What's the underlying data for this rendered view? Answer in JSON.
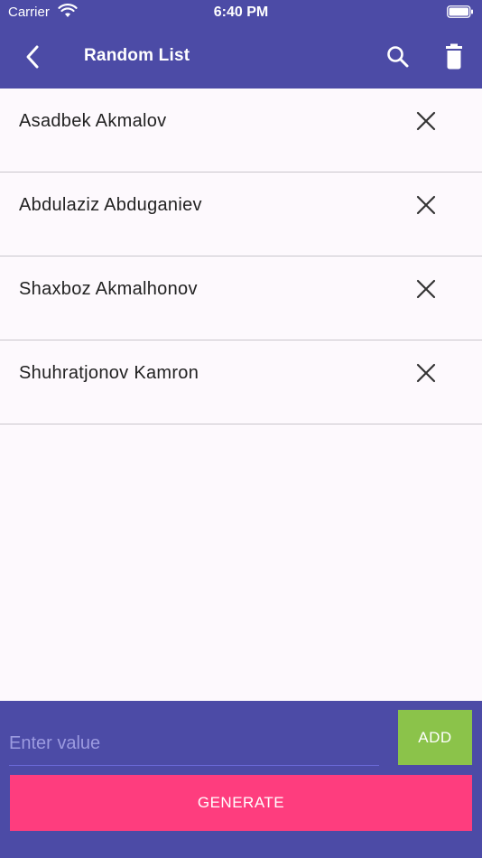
{
  "status": {
    "carrier": "Carrier",
    "time": "6:40 PM"
  },
  "appbar": {
    "title": "Random List"
  },
  "items": [
    {
      "name": "Asadbek  Akmalov"
    },
    {
      "name": "Abdulaziz Abduganiev"
    },
    {
      "name": "Shaxboz Akmalhonov"
    },
    {
      "name": "Shuhratjonov Kamron"
    }
  ],
  "input": {
    "value": "",
    "placeholder": "Enter value"
  },
  "buttons": {
    "add_label": "ADD",
    "generate_label": "GENERATE"
  },
  "colors": {
    "primary": "#4c4ba6",
    "add": "#8bc34a",
    "generate": "#fe3d7e",
    "background": "#fdf9fd"
  },
  "icons": {
    "back": "chevron-left-icon",
    "search": "search-icon",
    "trash": "trash-icon",
    "remove": "close-icon"
  }
}
